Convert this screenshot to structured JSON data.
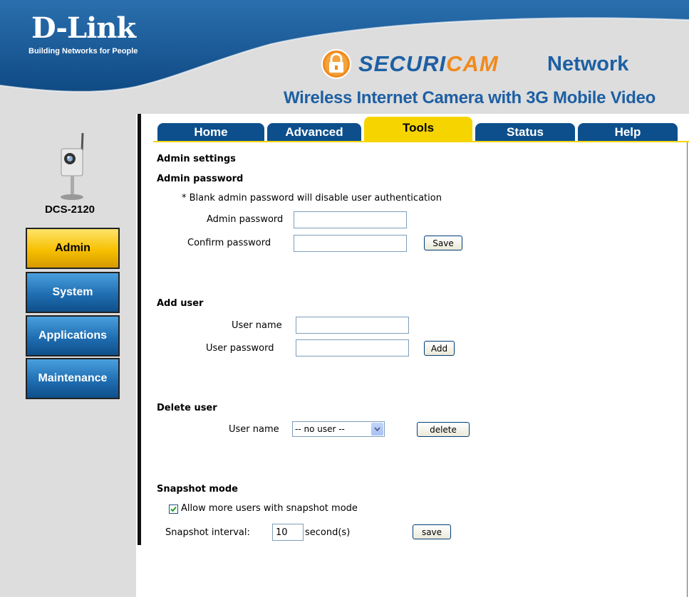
{
  "brand": {
    "logo_text": "D-Link",
    "tagline": "Building Networks for People"
  },
  "product": {
    "logo_part1": "SECURI",
    "logo_part2": "CAM",
    "logo_suffix": "Network",
    "subtitle": "Wireless Internet Camera with 3G Mobile Video"
  },
  "sidebar": {
    "model": "DCS-2120",
    "items": [
      {
        "label": "Admin",
        "active": true
      },
      {
        "label": "System",
        "active": false
      },
      {
        "label": "Applications",
        "active": false
      },
      {
        "label": "Maintenance",
        "active": false
      }
    ]
  },
  "tabs": [
    {
      "label": "Home",
      "active": false
    },
    {
      "label": "Advanced",
      "active": false
    },
    {
      "label": "Tools",
      "active": true
    },
    {
      "label": "Status",
      "active": false
    },
    {
      "label": "Help",
      "active": false
    }
  ],
  "admin": {
    "section_title": "Admin settings",
    "password_heading": "Admin password",
    "note": "* Blank admin password will disable user authentication",
    "admin_password_label": "Admin password",
    "admin_password_value": "",
    "confirm_password_label": "Confirm password",
    "confirm_password_value": "",
    "save_label": "Save"
  },
  "add_user": {
    "heading": "Add user",
    "user_name_label": "User name",
    "user_name_value": "",
    "user_password_label": "User password",
    "user_password_value": "",
    "add_label": "Add"
  },
  "delete_user": {
    "heading": "Delete user",
    "user_name_label": "User name",
    "selected": "-- no user --",
    "delete_label": "delete"
  },
  "snapshot": {
    "heading": "Snapshot mode",
    "allow_label": "Allow more users with snapshot mode",
    "allow_checked": true,
    "interval_label": "Snapshot interval:",
    "interval_value": "10",
    "interval_unit": "second(s)",
    "save_label": "save"
  },
  "colors": {
    "header_blue": "#1a5c9a",
    "tab_blue": "#0d4f8c",
    "active_yellow": "#f5d400",
    "accent_orange": "#f08a1c"
  }
}
